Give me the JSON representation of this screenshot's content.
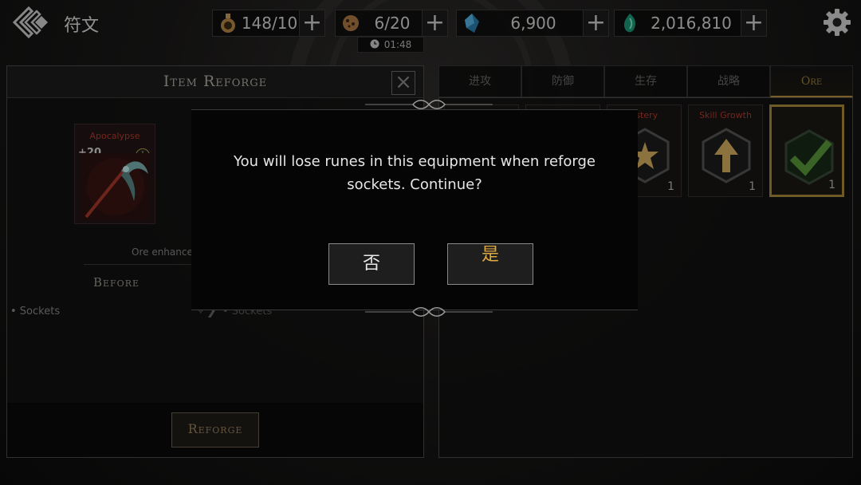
{
  "header": {
    "title": "符文",
    "resources": [
      {
        "icon": "potion-icon",
        "value": "148/10"
      },
      {
        "icon": "cookie-icon",
        "value": "6/20"
      },
      {
        "icon": "crystal-icon",
        "value": "6,900"
      },
      {
        "icon": "green-gem-icon",
        "value": "2,016,810"
      }
    ],
    "timer": "01:48"
  },
  "left_panel": {
    "title": "Item Reforge",
    "item": {
      "name": "Apocalypse",
      "level": "+20",
      "rank": "I"
    },
    "ore_note": "Ore enhanced u",
    "before_label": "Before",
    "sockets_before": "• Sockets",
    "sockets_after": "• Sockets",
    "reforge_label": "Reforge"
  },
  "right_panel": {
    "tabs": [
      "进攻",
      "防御",
      "生存",
      "战略",
      "Ore"
    ],
    "active_tab": 4,
    "runes": [
      {
        "name": "ystery",
        "count": "1"
      },
      {
        "name": "Skill Growth",
        "count": "1"
      },
      {
        "name": "",
        "count": "1"
      }
    ]
  },
  "modal": {
    "message": "You will lose runes in this equipment when reforge sockets. Continue?",
    "no_label": "否",
    "yes_label": "是"
  },
  "colors": {
    "accent_gold": "#b89040",
    "rune_name_red": "#b53a2a",
    "yes_orange": "#e0a840"
  }
}
